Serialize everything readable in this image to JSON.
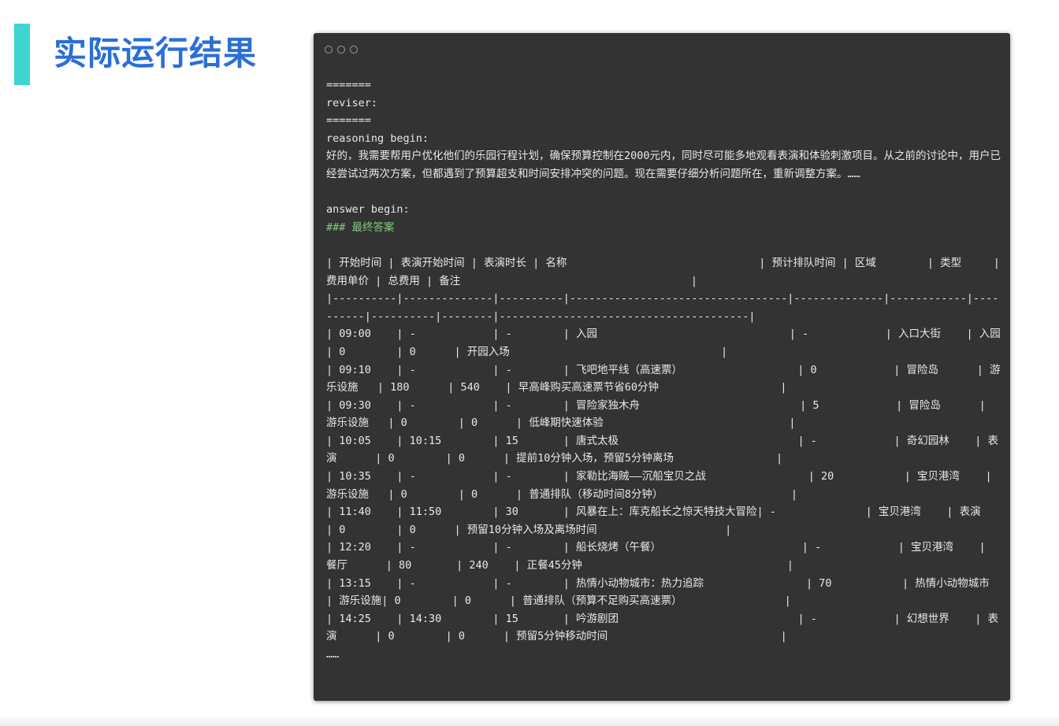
{
  "slide": {
    "title": "实际运行结果",
    "accent_color": "#3fd6cf",
    "title_color": "#2a6fd6"
  },
  "terminal": {
    "background": "#333333",
    "window_controls": [
      "close",
      "minimize",
      "zoom"
    ],
    "lines": [
      {
        "text": "=======",
        "style": "normal"
      },
      {
        "text": "reviser:",
        "style": "normal"
      },
      {
        "text": "=======",
        "style": "normal"
      },
      {
        "text": "reasoning begin:",
        "style": "normal"
      },
      {
        "text": "好的，我需要帮用户优化他们的乐园行程计划，确保预算控制在2000元内，同时尽可能多地观看表演和体验刺激项目。从之前的讨论中，用户已经尝试过两次方案，但都遇到了预算超支和时间安排冲突的问题。现在需要仔细分析问题所在，重新调整方案。……",
        "style": "normal"
      },
      {
        "text": "",
        "style": "normal"
      },
      {
        "text": "answer begin:",
        "style": "normal"
      },
      {
        "text": "### 最终答案",
        "style": "md-heading"
      },
      {
        "text": "",
        "style": "normal"
      },
      {
        "text": "| 开始时间 | 表演开始时间 | 表演时长 | 名称                              | 预计排队时间 | 区域        | 类型     | 费用单价 | 总费用 | 备注                                    |",
        "style": "normal"
      },
      {
        "text": "|----------|--------------|----------|----------------------------------|--------------|------------|----------|----------|--------|---------------------------------------|",
        "style": "normal"
      },
      {
        "text": "| 09:00    | -            | -        | 入园                              | -            | 入口大街    | 入园      | 0        | 0      | 开园入场                                 |",
        "style": "normal"
      },
      {
        "text": "| 09:10    | -            | -        | 飞吧地平线（高速票）                  | 0            | 冒险岛      | 游乐设施   | 180      | 540    | 早高峰购买高速票节省60分钟                   |",
        "style": "normal"
      },
      {
        "text": "| 09:30    | -            | -        | 冒险家独木舟                         | 5            | 冒险岛      | 游乐设施   | 0        | 0      | 低峰期快速体验                             |",
        "style": "normal"
      },
      {
        "text": "| 10:05    | 10:15        | 15       | 唐式太极                            | -            | 奇幻园林    | 表演      | 0        | 0      | 提前10分钟入场，预留5分钟离场                |",
        "style": "normal"
      },
      {
        "text": "| 10:35    | -            | -        | 家勒比海贼——沉船宝贝之战                | 20           | 宝贝港湾    | 游乐设施   | 0        | 0      | 普通排队（移动时间8分钟）                    |",
        "style": "normal"
      },
      {
        "text": "| 11:40    | 11:50        | 30       | 风暴在上：库克船长之惊天特技大冒险| -              | 宝贝港湾    | 表演      | 0        | 0      | 预留10分钟入场及离场时间                    |",
        "style": "normal"
      },
      {
        "text": "| 12:20    | -            | -        | 船长烧烤（午餐）                      | -            | 宝贝港湾    | 餐厅      | 80       | 240    | 正餐45分钟                                |",
        "style": "normal"
      },
      {
        "text": "| 13:15    | -            | -        | 热情小动物城市：热力追踪                | 70           | 热情小动物城市 | 游乐设施| 0        | 0      | 普通排队（预算不足购买高速票）                |",
        "style": "normal"
      },
      {
        "text": "| 14:25    | 14:30        | 15       | 吟游剧团                            | -            | 幻想世界    | 表演      | 0        | 0      | 预留5分钟移动时间                           |",
        "style": "normal"
      },
      {
        "text": "……",
        "style": "normal"
      }
    ]
  }
}
